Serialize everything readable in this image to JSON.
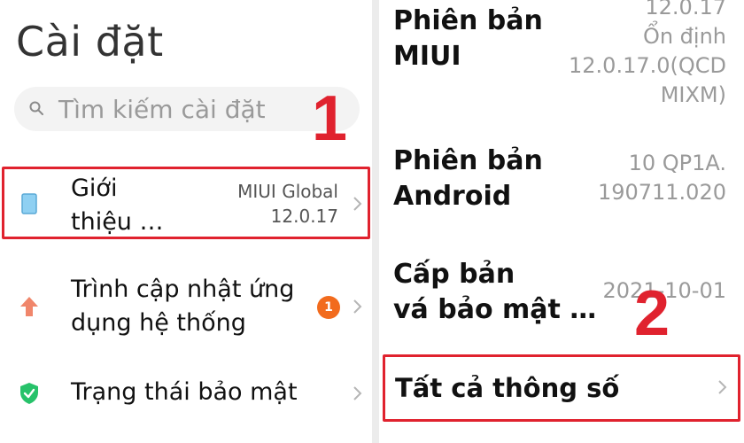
{
  "left": {
    "title": "Cài đặt",
    "search": {
      "placeholder": "Tìm kiếm cài đặt",
      "icon": "search-icon"
    },
    "items": [
      {
        "label_line1": "Giới",
        "label_line2": "thiệu …",
        "value_line1": "MIUI Global",
        "value_line2": "12.0.17",
        "icon": "phone-icon",
        "icon_color": "#7fc7ef"
      },
      {
        "label_line1": "Trình cập nhật ứng",
        "label_line2": "dụng hệ thống",
        "badge": "1",
        "icon": "arrow-up-icon",
        "icon_color": "#f0866b"
      },
      {
        "label": "Trạng thái bảo mật",
        "icon": "shield-check-icon",
        "icon_color": "#27c26a"
      }
    ]
  },
  "right": {
    "items": [
      {
        "label_line1": "Phiên bản",
        "label_line2": "MIUI",
        "value_lines": [
          "12.0.17",
          "Ổn định",
          "12.0.17.0(QCD",
          "MIXM)"
        ]
      },
      {
        "label_line1": "Phiên bản",
        "label_line2": "Android",
        "value_lines": [
          "10 QP1A.",
          "190711.020"
        ]
      },
      {
        "label_line1": "Cấp bản",
        "label_line2": "vá bảo mật …",
        "value": "2021-10-01"
      },
      {
        "label": "Tất cả thông số"
      }
    ]
  },
  "annotations": {
    "step1": "1",
    "step2": "2",
    "highlight_color": "#e0222e"
  }
}
